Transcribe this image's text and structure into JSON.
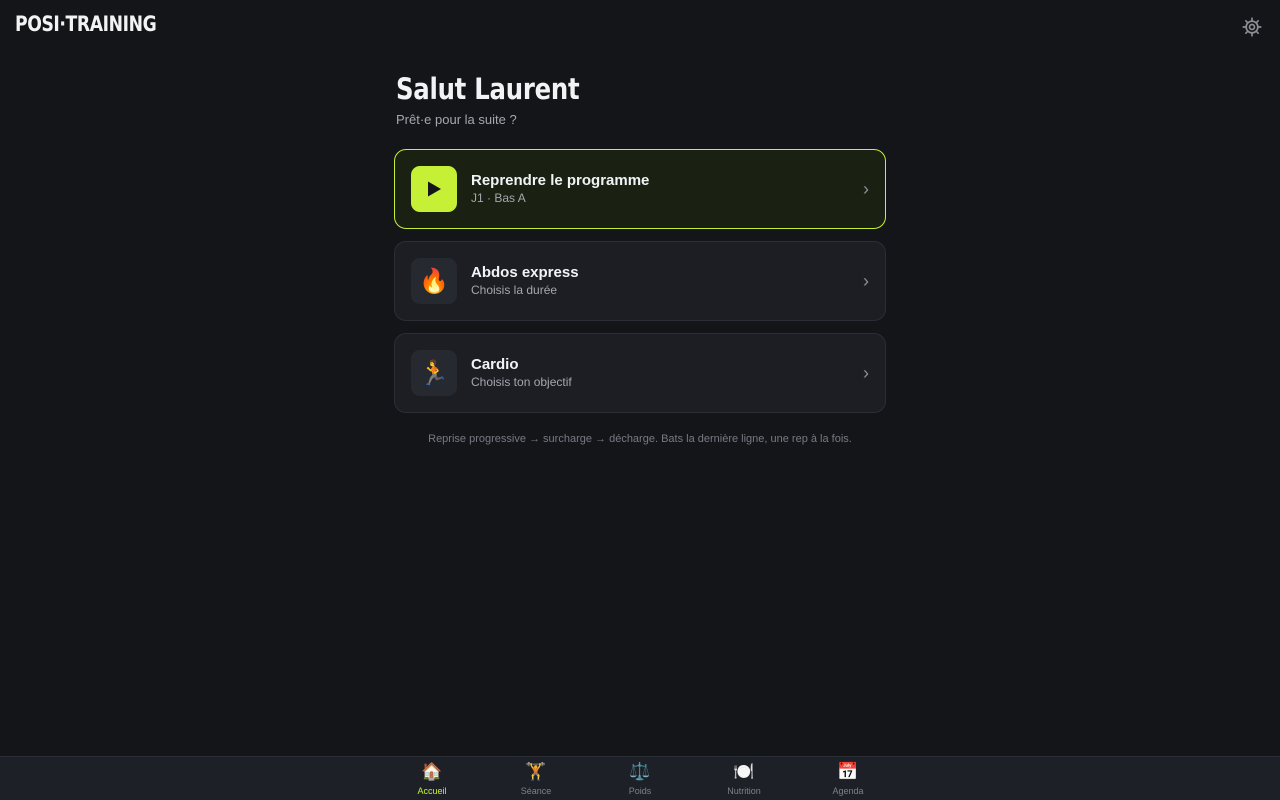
{
  "app": {
    "logo": "POSI·TRAINING",
    "settings_icon": "gear-icon"
  },
  "home": {
    "greeting": "Salut Laurent",
    "subtitle": "Prêt·e pour la suite ?",
    "cards": [
      {
        "title": "Reprendre le programme",
        "subtitle": "J1 · Bas A",
        "icon": "play-icon",
        "highlighted": true
      },
      {
        "title": "Abdos express",
        "subtitle": "Choisis la durée",
        "icon": "🔥"
      },
      {
        "title": "Cardio",
        "subtitle": "Choisis ton objectif",
        "icon": "🏃"
      }
    ],
    "footnote": "Reprise progressive → surcharge → décharge. Bats la dernière ligne, une rep à la fois."
  },
  "nav": {
    "items": [
      {
        "label": "Accueil",
        "icon": "🏠",
        "active": true
      },
      {
        "label": "Séance",
        "icon": "🏋️"
      },
      {
        "label": "Poids",
        "icon": "⚖️"
      },
      {
        "label": "Nutrition",
        "icon": "🍽️"
      },
      {
        "label": "Agenda",
        "icon": "📅"
      }
    ]
  },
  "colors": {
    "background": "#141518",
    "accent": "#c6f035",
    "card": "#1c1e23",
    "nav_background": "#1d2027"
  }
}
